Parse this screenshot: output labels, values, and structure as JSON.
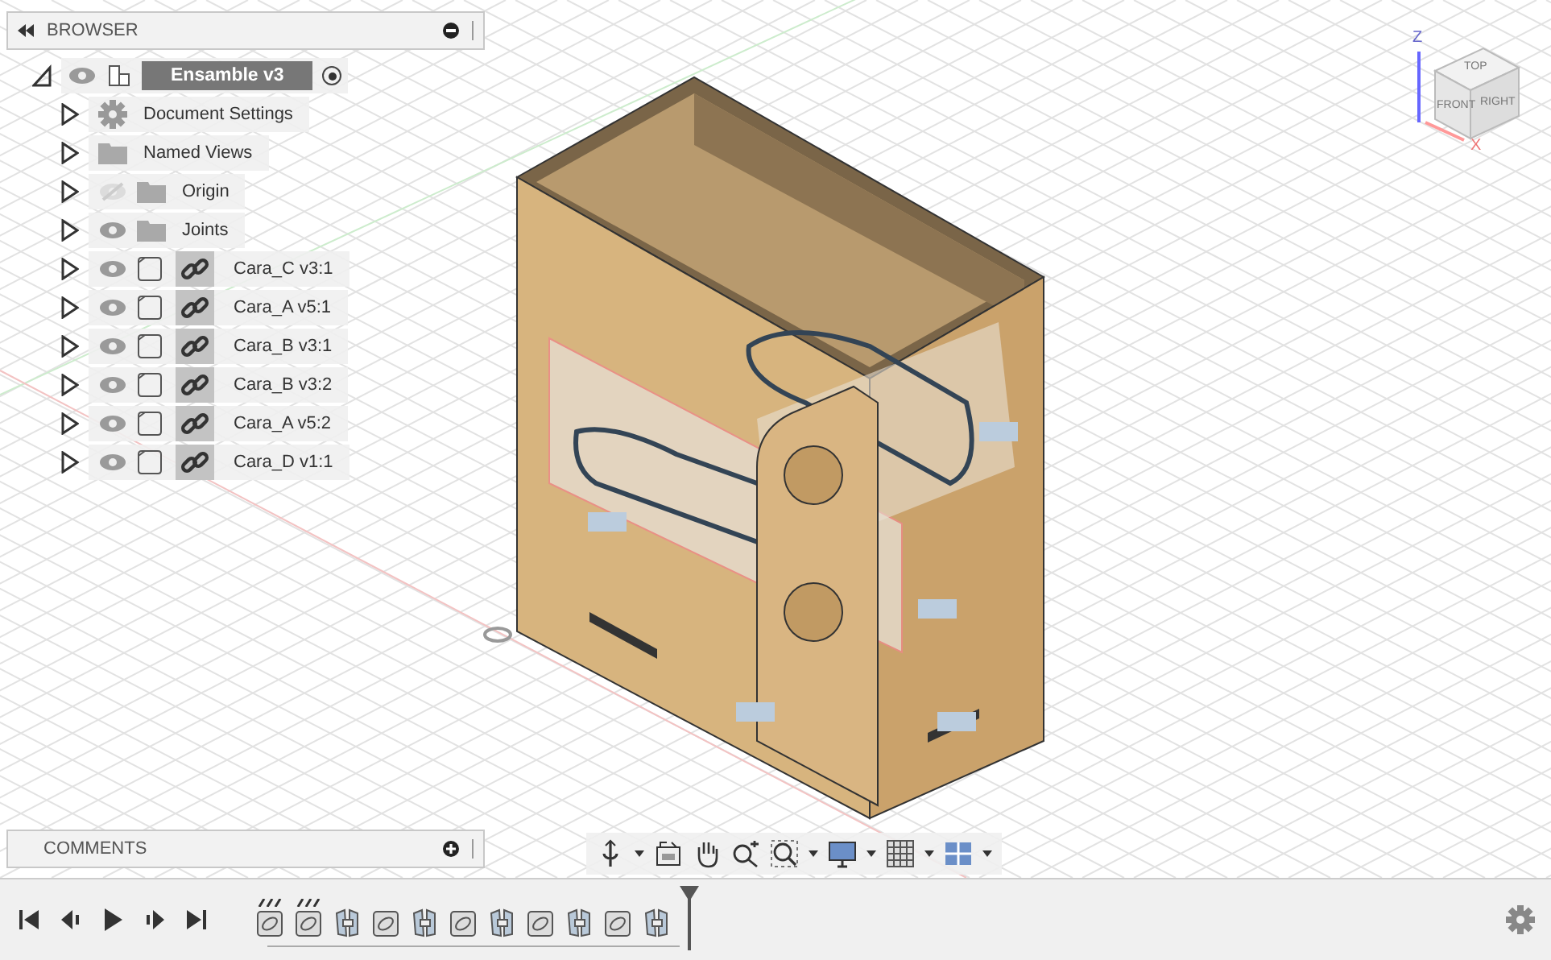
{
  "browser": {
    "title": "BROWSER",
    "root": {
      "label": "Ensamble v3",
      "expanded": true,
      "active": true,
      "children": [
        {
          "kind": "settings",
          "label": "Document Settings",
          "expanded": false
        },
        {
          "kind": "folder",
          "label": "Named Views",
          "expanded": false
        },
        {
          "kind": "folder",
          "label": "Origin",
          "expanded": false,
          "visible": false
        },
        {
          "kind": "folder",
          "label": "Joints",
          "expanded": false,
          "visible": true
        },
        {
          "kind": "component",
          "label": "Cara_C v3:1",
          "expanded": false,
          "visible": true
        },
        {
          "kind": "component",
          "label": "Cara_A v5:1",
          "expanded": false,
          "visible": true
        },
        {
          "kind": "component",
          "label": "Cara_B v3:1",
          "expanded": false,
          "visible": true
        },
        {
          "kind": "component",
          "label": "Cara_B v3:2",
          "expanded": false,
          "visible": true
        },
        {
          "kind": "component",
          "label": "Cara_A v5:2",
          "expanded": false,
          "visible": true
        },
        {
          "kind": "component",
          "label": "Cara_D v1:1",
          "expanded": false,
          "visible": true
        }
      ]
    }
  },
  "viewcube": {
    "top": "TOP",
    "front": "FRONT",
    "right": "RIGHT",
    "z_axis": "Z",
    "x_axis": "X"
  },
  "comments": {
    "title": "COMMENTS"
  },
  "timeline": {
    "features": [
      {
        "kind": "joint",
        "flagged": true
      },
      {
        "kind": "joint",
        "flagged": true
      },
      {
        "kind": "component",
        "flagged": false
      },
      {
        "kind": "joint",
        "flagged": false
      },
      {
        "kind": "component",
        "flagged": false
      },
      {
        "kind": "joint",
        "flagged": false
      },
      {
        "kind": "component",
        "flagged": false
      },
      {
        "kind": "joint",
        "flagged": false
      },
      {
        "kind": "component",
        "flagged": false
      },
      {
        "kind": "joint",
        "flagged": false
      },
      {
        "kind": "component",
        "flagged": false
      }
    ]
  }
}
